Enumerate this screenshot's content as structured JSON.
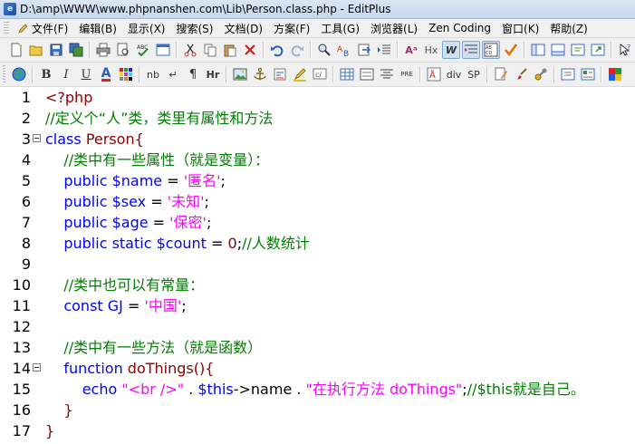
{
  "window": {
    "title": "D:\\amp\\WWW\\www.phpnanshen.com\\Lib\\Person.class.php - EditPlus",
    "app_icon_letter": "e"
  },
  "menu": {
    "items": [
      "文件(F)",
      "编辑(B)",
      "显示(X)",
      "搜索(S)",
      "文档(D)",
      "方案(F)",
      "工具(G)",
      "浏览器(L)",
      "Zen Coding",
      "窗口(K)",
      "帮助(Z)"
    ]
  },
  "toolbar2": {
    "bold": "B",
    "italic": "I",
    "underline": "U",
    "font_color": "A",
    "nbsp": "nb",
    "br": "↵",
    "pilcrow": "¶",
    "hr": "Hr",
    "pre": "PRE",
    "div": "div",
    "span": "SP"
  },
  "toolbar1": {
    "font_size_btn": "Aᵃ",
    "header_btn": "Hx",
    "word_wrap_btn": "W"
  },
  "editor": {
    "lines": [
      {
        "n": "1",
        "fold": false,
        "tokens": [
          {
            "t": "<?php",
            "c": "red"
          }
        ]
      },
      {
        "n": "2",
        "fold": false,
        "tokens": [
          {
            "t": "//定义个“人”类，类里有属性和方法",
            "c": "cmt"
          }
        ]
      },
      {
        "n": "3",
        "fold": true,
        "tokens": [
          {
            "t": "class ",
            "c": "kw"
          },
          {
            "t": "Person{",
            "c": "red"
          }
        ]
      },
      {
        "n": "4",
        "fold": false,
        "tokens": [
          {
            "t": "    //类中有一些属性（就是变量）：",
            "c": "cmt"
          }
        ]
      },
      {
        "n": "5",
        "fold": false,
        "tokens": [
          {
            "t": "    public ",
            "c": "kw"
          },
          {
            "t": "$name",
            "c": "kw"
          },
          {
            "t": " = ",
            "c": "pl"
          },
          {
            "t": "'匿名'",
            "c": "str"
          },
          {
            "t": ";",
            "c": "pl"
          }
        ]
      },
      {
        "n": "6",
        "fold": false,
        "tokens": [
          {
            "t": "    public ",
            "c": "kw"
          },
          {
            "t": "$sex",
            "c": "kw"
          },
          {
            "t": " = ",
            "c": "pl"
          },
          {
            "t": "'未知'",
            "c": "str"
          },
          {
            "t": ";",
            "c": "pl"
          }
        ]
      },
      {
        "n": "7",
        "fold": false,
        "tokens": [
          {
            "t": "    public ",
            "c": "kw"
          },
          {
            "t": "$age",
            "c": "kw"
          },
          {
            "t": " = ",
            "c": "pl"
          },
          {
            "t": "'保密'",
            "c": "str"
          },
          {
            "t": ";",
            "c": "pl"
          }
        ]
      },
      {
        "n": "8",
        "fold": false,
        "tokens": [
          {
            "t": "    public static ",
            "c": "kw"
          },
          {
            "t": "$count",
            "c": "kw"
          },
          {
            "t": " = ",
            "c": "pl"
          },
          {
            "t": "0",
            "c": "red"
          },
          {
            "t": ";",
            "c": "pl"
          },
          {
            "t": "//人数统计",
            "c": "cmt"
          }
        ]
      },
      {
        "n": "9",
        "fold": false,
        "tokens": []
      },
      {
        "n": "10",
        "fold": false,
        "tokens": [
          {
            "t": "    //类中也可以有常量：",
            "c": "cmt"
          }
        ]
      },
      {
        "n": "11",
        "fold": false,
        "tokens": [
          {
            "t": "    const ",
            "c": "kw"
          },
          {
            "t": "GJ",
            "c": "kw"
          },
          {
            "t": " = ",
            "c": "pl"
          },
          {
            "t": "'中国'",
            "c": "str"
          },
          {
            "t": ";",
            "c": "pl"
          }
        ]
      },
      {
        "n": "12",
        "fold": false,
        "tokens": []
      },
      {
        "n": "13",
        "fold": false,
        "tokens": [
          {
            "t": "    //类中有一些方法（就是函数）",
            "c": "cmt"
          }
        ]
      },
      {
        "n": "14",
        "fold": true,
        "tokens": [
          {
            "t": "    function ",
            "c": "kw"
          },
          {
            "t": "doThings(){",
            "c": "red"
          }
        ]
      },
      {
        "n": "15",
        "fold": false,
        "tokens": [
          {
            "t": "        echo ",
            "c": "kw"
          },
          {
            "t": "\"<br />\"",
            "c": "str"
          },
          {
            "t": " . ",
            "c": "pl"
          },
          {
            "t": "$this",
            "c": "kw"
          },
          {
            "t": "->name . ",
            "c": "pl"
          },
          {
            "t": "\"在执行方法 doThings\"",
            "c": "str"
          },
          {
            "t": ";",
            "c": "pl"
          },
          {
            "t": "//$this就是自己。",
            "c": "cmt"
          }
        ]
      },
      {
        "n": "16",
        "fold": false,
        "tokens": [
          {
            "t": "    }",
            "c": "red"
          }
        ]
      },
      {
        "n": "17",
        "fold": false,
        "tokens": [
          {
            "t": "}",
            "c": "red"
          }
        ]
      }
    ]
  },
  "colors": {
    "keyword": "#0000ff",
    "string": "#ff00ff",
    "comment": "#008000",
    "brace": "#8b0000"
  }
}
